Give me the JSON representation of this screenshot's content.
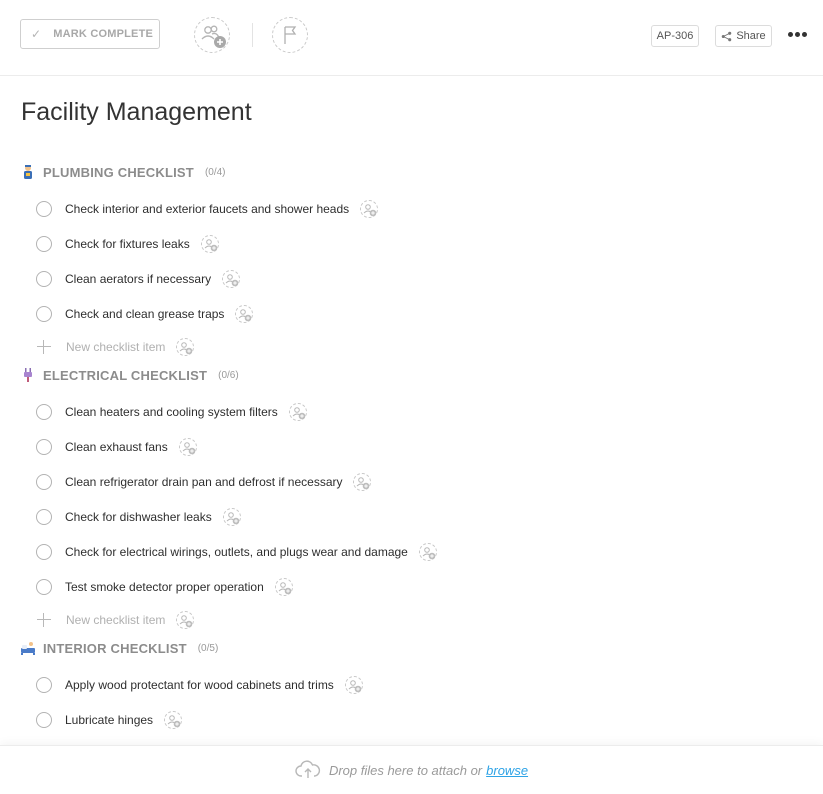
{
  "toolbar": {
    "mark_complete_label": "MARK COMPLETE",
    "task_id": "AP-306",
    "share_label": "Share"
  },
  "page": {
    "title": "Facility Management"
  },
  "sections": [
    {
      "name": "PLUMBING CHECKLIST",
      "count": "(0/4)",
      "icon": "plumber-icon",
      "items": [
        "Check interior and exterior faucets and shower heads",
        "Check for fixtures leaks",
        "Clean aerators if necessary",
        "Check and clean grease traps"
      ],
      "new_item_placeholder": "New checklist item"
    },
    {
      "name": "ELECTRICAL CHECKLIST",
      "count": "(0/6)",
      "icon": "plug-icon",
      "items": [
        "Clean heaters and cooling system filters",
        "Clean exhaust fans",
        "Clean refrigerator drain pan and defrost if necessary",
        "Check for dishwasher leaks",
        "Check for electrical wirings, outlets, and plugs wear and damage",
        "Test smoke detector proper operation"
      ],
      "new_item_placeholder": "New checklist item"
    },
    {
      "name": "INTERIOR CHECKLIST",
      "count": "(0/5)",
      "icon": "bed-icon",
      "items": [
        "Apply wood protectant for wood cabinets and trims",
        "Lubricate hinges"
      ]
    }
  ],
  "footer": {
    "drop_text": "Drop files here to attach or",
    "browse_label": "browse"
  }
}
